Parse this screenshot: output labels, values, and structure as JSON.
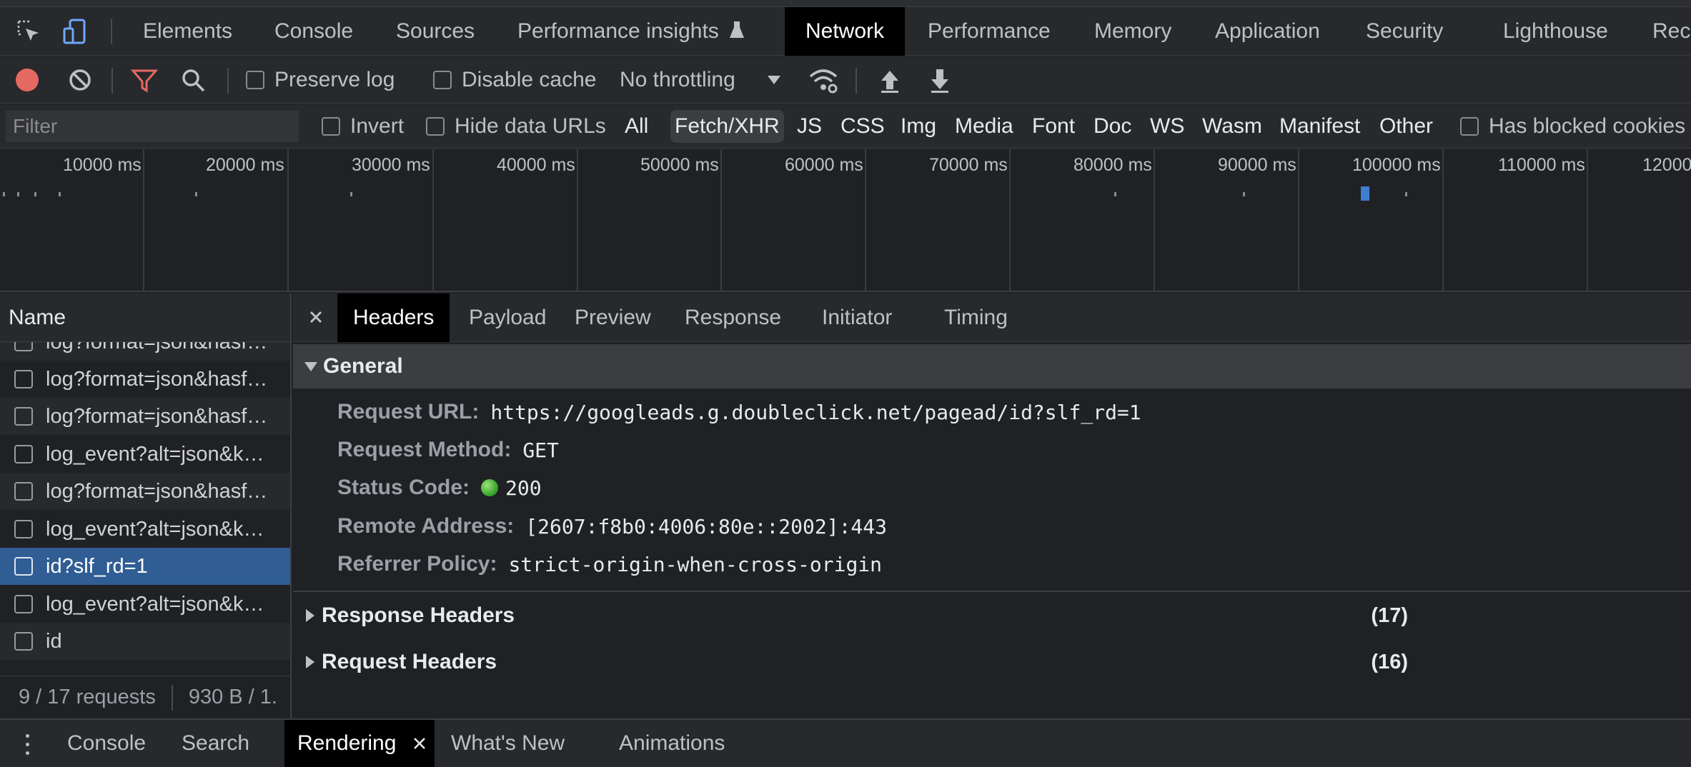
{
  "main_tabs": [
    "Elements",
    "Console",
    "Sources",
    "Performance insights",
    "Network",
    "Performance",
    "Memory",
    "Application",
    "Security",
    "Lighthouse",
    "Rec"
  ],
  "active_main_tab": "Network",
  "toolbar": {
    "preserve_log": "Preserve log",
    "disable_cache": "Disable cache",
    "throttling": "No throttling"
  },
  "filter": {
    "placeholder": "Filter",
    "invert": "Invert",
    "hide_data_urls": "Hide data URLs",
    "types": [
      "All",
      "Fetch/XHR",
      "JS",
      "CSS",
      "Img",
      "Media",
      "Font",
      "Doc",
      "WS",
      "Wasm",
      "Manifest",
      "Other"
    ],
    "active_type": "Fetch/XHR",
    "has_blocked_cookies": "Has blocked cookies"
  },
  "timeline": {
    "labels": [
      "10000 ms",
      "20000 ms",
      "30000 ms",
      "40000 ms",
      "50000 ms",
      "60000 ms",
      "70000 ms",
      "80000 ms",
      "90000 ms",
      "100000 ms",
      "110000 ms",
      "12000"
    ]
  },
  "requests": {
    "header": "Name",
    "items": [
      "log?format=json&hasf…",
      "log?format=json&hasf…",
      "log?format=json&hasf…",
      "log_event?alt=json&k…",
      "log?format=json&hasf…",
      "log_event?alt=json&k…",
      "id?slf_rd=1",
      "log_event?alt=json&k…",
      "id"
    ],
    "selected": "id?slf_rd=1",
    "summary_count": "9 / 17 requests",
    "summary_size": "930 B / 1."
  },
  "detail_tabs": [
    "Headers",
    "Payload",
    "Preview",
    "Response",
    "Initiator",
    "Timing"
  ],
  "active_detail_tab": "Headers",
  "general": {
    "title": "General",
    "request_url_label": "Request URL:",
    "request_url": "https://googleads.g.doubleclick.net/pagead/id?slf_rd=1",
    "request_method_label": "Request Method:",
    "request_method": "GET",
    "status_code_label": "Status Code:",
    "status_code": "200",
    "remote_address_label": "Remote Address:",
    "remote_address": "[2607:f8b0:4006:80e::2002]:443",
    "referrer_policy_label": "Referrer Policy:",
    "referrer_policy": "strict-origin-when-cross-origin"
  },
  "response_headers": {
    "title": "Response Headers",
    "count": "(17)"
  },
  "request_headers": {
    "title": "Request Headers",
    "count": "(16)"
  },
  "drawer_tabs": [
    "Console",
    "Search",
    "Rendering",
    "What's New",
    "Animations"
  ],
  "active_drawer_tab": "Rendering",
  "colors": {
    "selected_row": "#2f5d94",
    "record_button": "#e46962",
    "filter_icon": "#e46962",
    "status_ok": "#35a52a"
  }
}
